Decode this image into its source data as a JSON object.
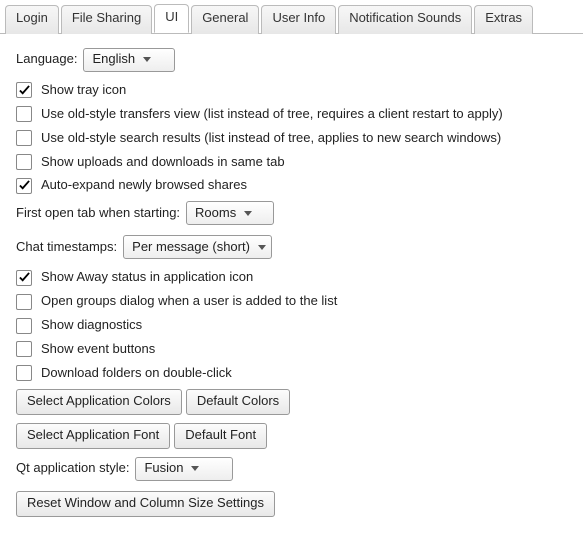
{
  "tabs": [
    "Login",
    "File Sharing",
    "UI",
    "General",
    "User Info",
    "Notification Sounds",
    "Extras"
  ],
  "activeTab": 2,
  "language": {
    "label": "Language:",
    "value": "English"
  },
  "checks": [
    {
      "label": "Show tray icon",
      "checked": true
    },
    {
      "label": "Use old-style transfers view (list instead of tree, requires a client restart to apply)",
      "checked": false
    },
    {
      "label": "Use old-style search results (list instead of tree, applies to new search windows)",
      "checked": false
    },
    {
      "label": "Show uploads and downloads in same tab",
      "checked": false
    },
    {
      "label": "Auto-expand newly browsed shares",
      "checked": true
    }
  ],
  "firstTab": {
    "label": "First open tab when starting:",
    "value": "Rooms"
  },
  "timestamps": {
    "label": "Chat timestamps:",
    "value": "Per message (short)"
  },
  "checks2": [
    {
      "label": "Show Away status in application icon",
      "checked": true
    },
    {
      "label": "Open groups dialog when a user is added to the list",
      "checked": false
    },
    {
      "label": "Show diagnostics",
      "checked": false
    },
    {
      "label": "Show event buttons",
      "checked": false
    },
    {
      "label": "Download folders on double-click",
      "checked": false
    }
  ],
  "btns": {
    "selColors": "Select Application Colors",
    "defColors": "Default Colors",
    "selFont": "Select Application Font",
    "defFont": "Default Font",
    "reset": "Reset Window and Column Size Settings"
  },
  "qtStyle": {
    "label": "Qt application style:",
    "value": "Fusion"
  }
}
